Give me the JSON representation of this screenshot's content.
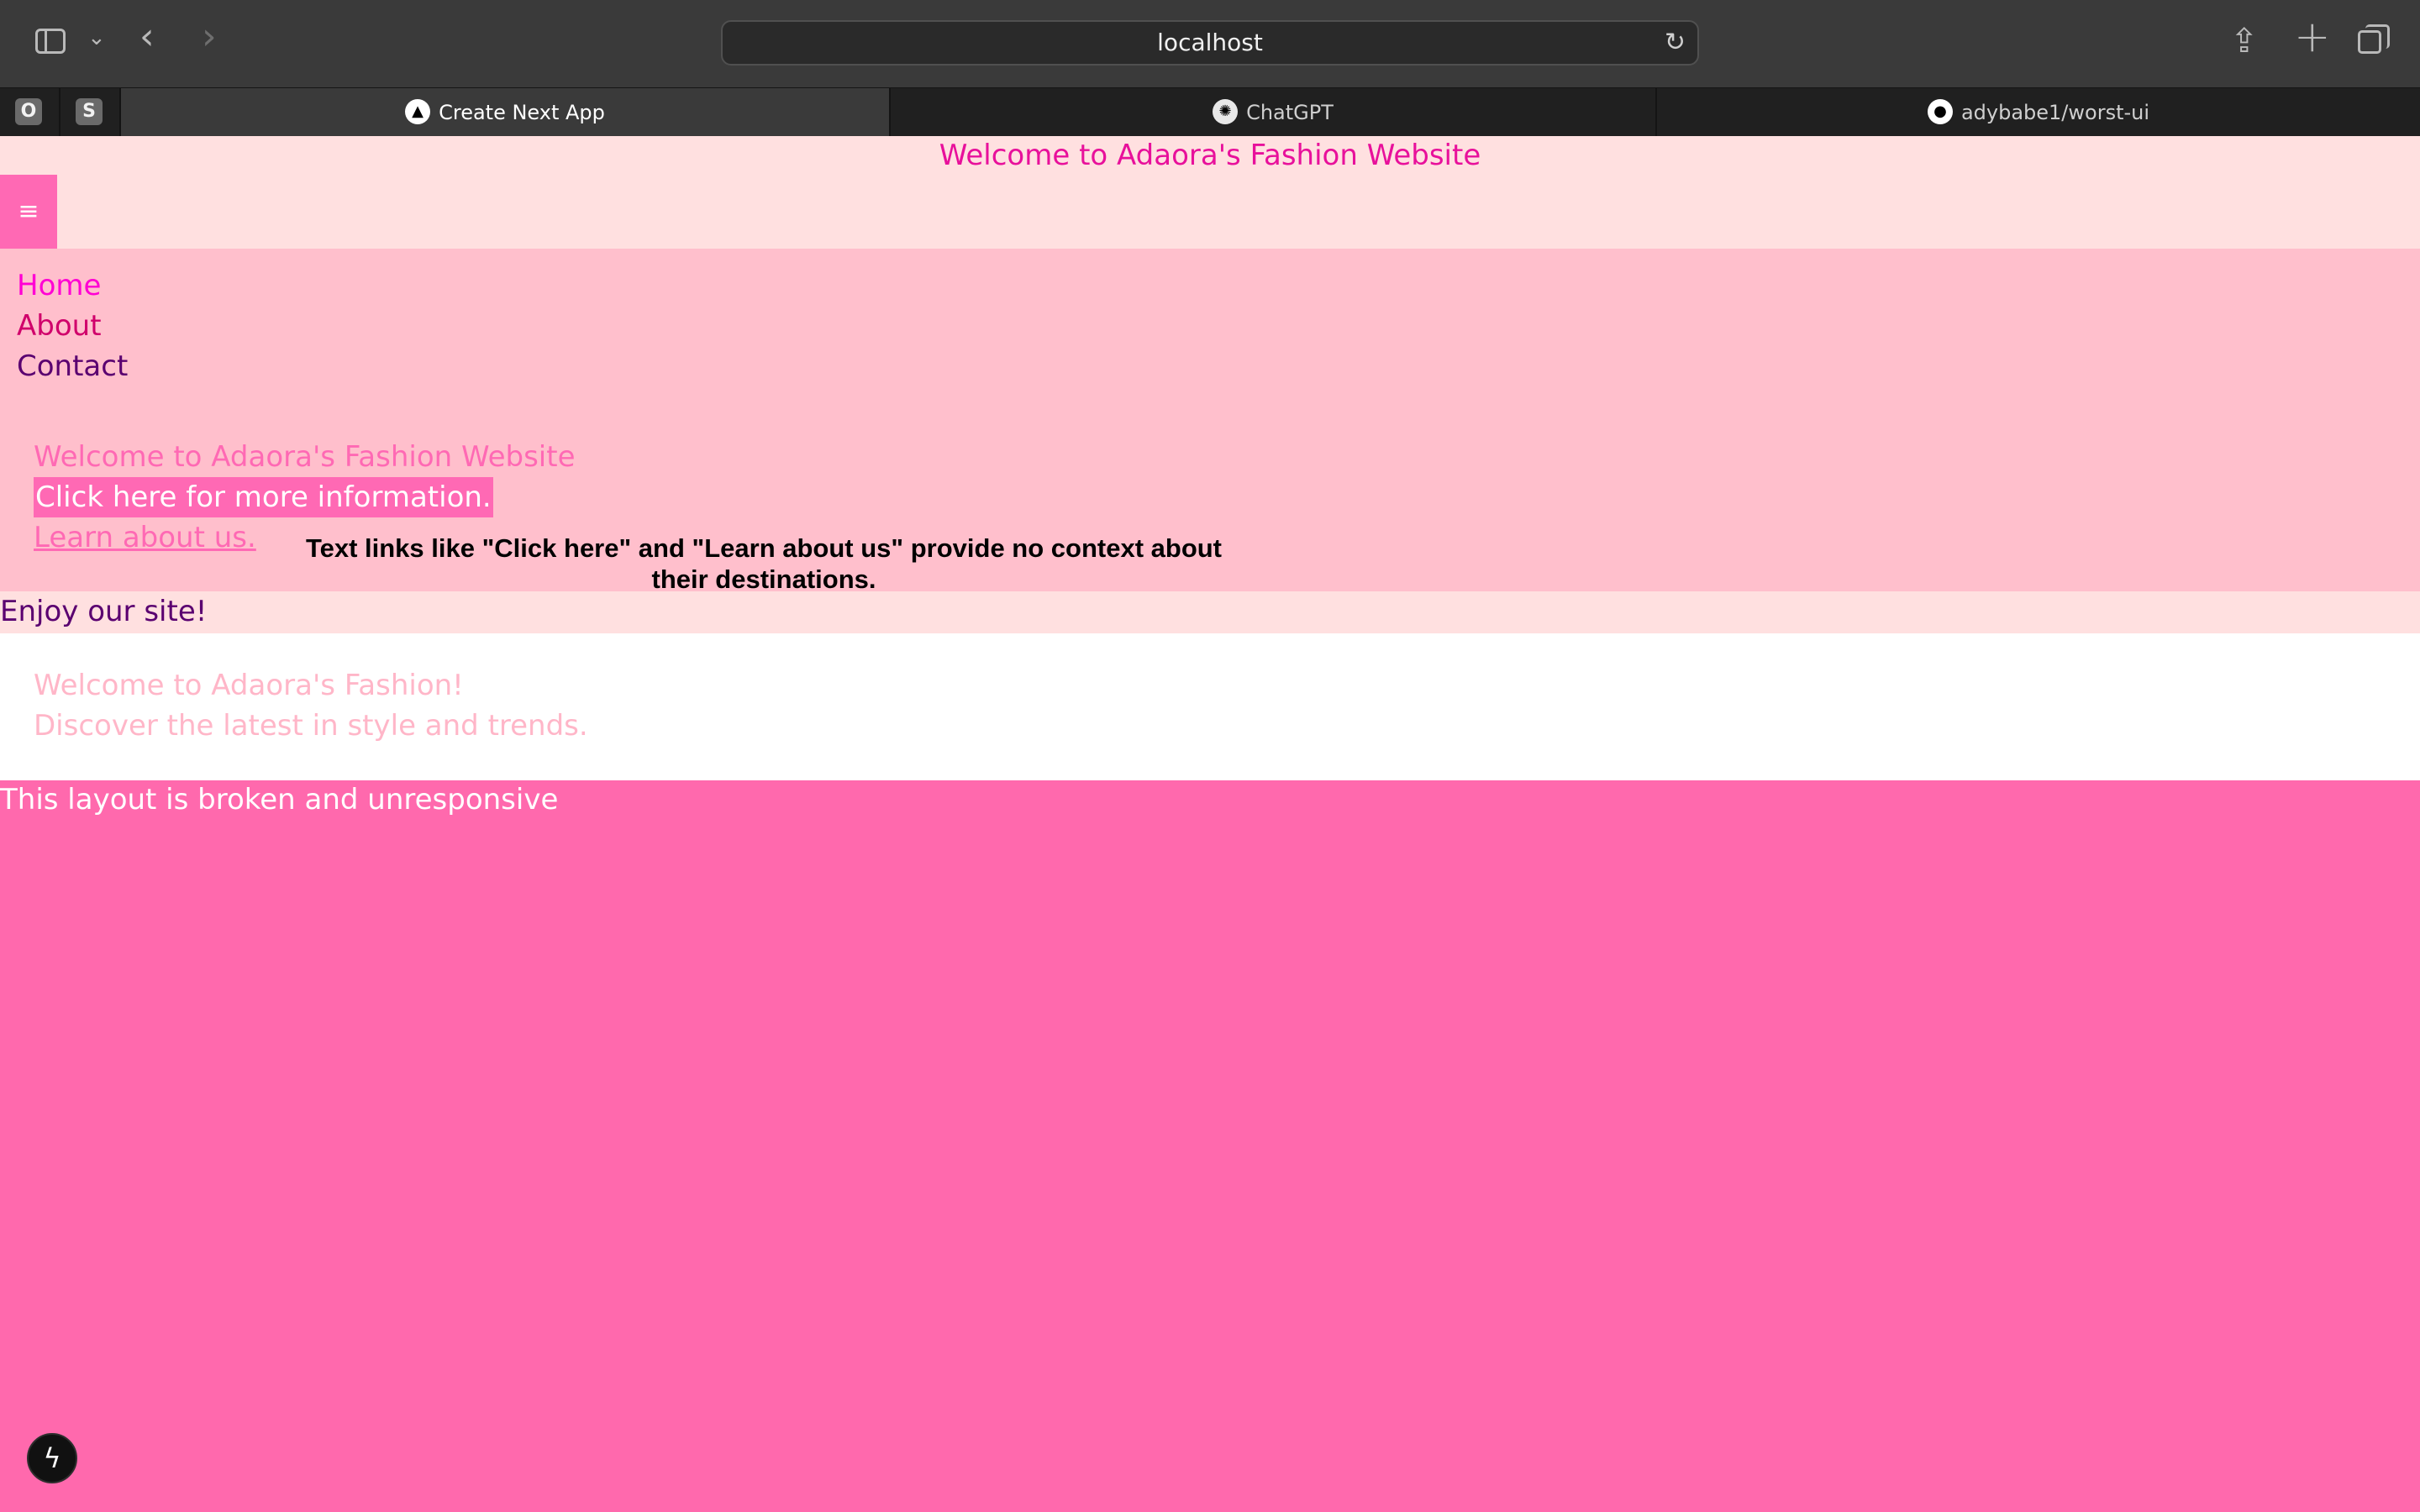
{
  "browser": {
    "url": "localhost",
    "pinned_tabs": [
      "O",
      "S"
    ],
    "tabs": [
      {
        "title": "Create Next App",
        "active": true,
        "icon": "nextjs-triangle-icon"
      },
      {
        "title": "ChatGPT",
        "active": false,
        "icon": "openai-icon"
      },
      {
        "title": "adybabe1/worst-ui",
        "active": false,
        "icon": "github-icon"
      }
    ]
  },
  "page": {
    "header_title": "Welcome to Adaora's Fashion Website",
    "menu_icon": "≡",
    "nav": [
      {
        "label": "Home",
        "color": "#ff00d4"
      },
      {
        "label": "About",
        "color": "#d0006b"
      },
      {
        "label": "Contact",
        "color": "#5a0070"
      }
    ],
    "hero_title": "Welcome to Adaora's Fashion Website",
    "click_here": "Click here for more information.",
    "learn_about": "Learn about us.",
    "annotation": "Text links like \"Click here\" and \"Learn about us\" provide no context about their destinations.",
    "enjoy": "Enjoy our site!",
    "welcome2": "Welcome to Adaora's Fashion!",
    "discover": "Discover the latest in style and trends.",
    "broken": "This layout is broken and unresponsive"
  },
  "colors": {
    "page_bg": "#ff69ad",
    "header_bg": "#ffe0e0",
    "nav_bg": "#ffbfcc",
    "accent": "#ff69b4"
  }
}
